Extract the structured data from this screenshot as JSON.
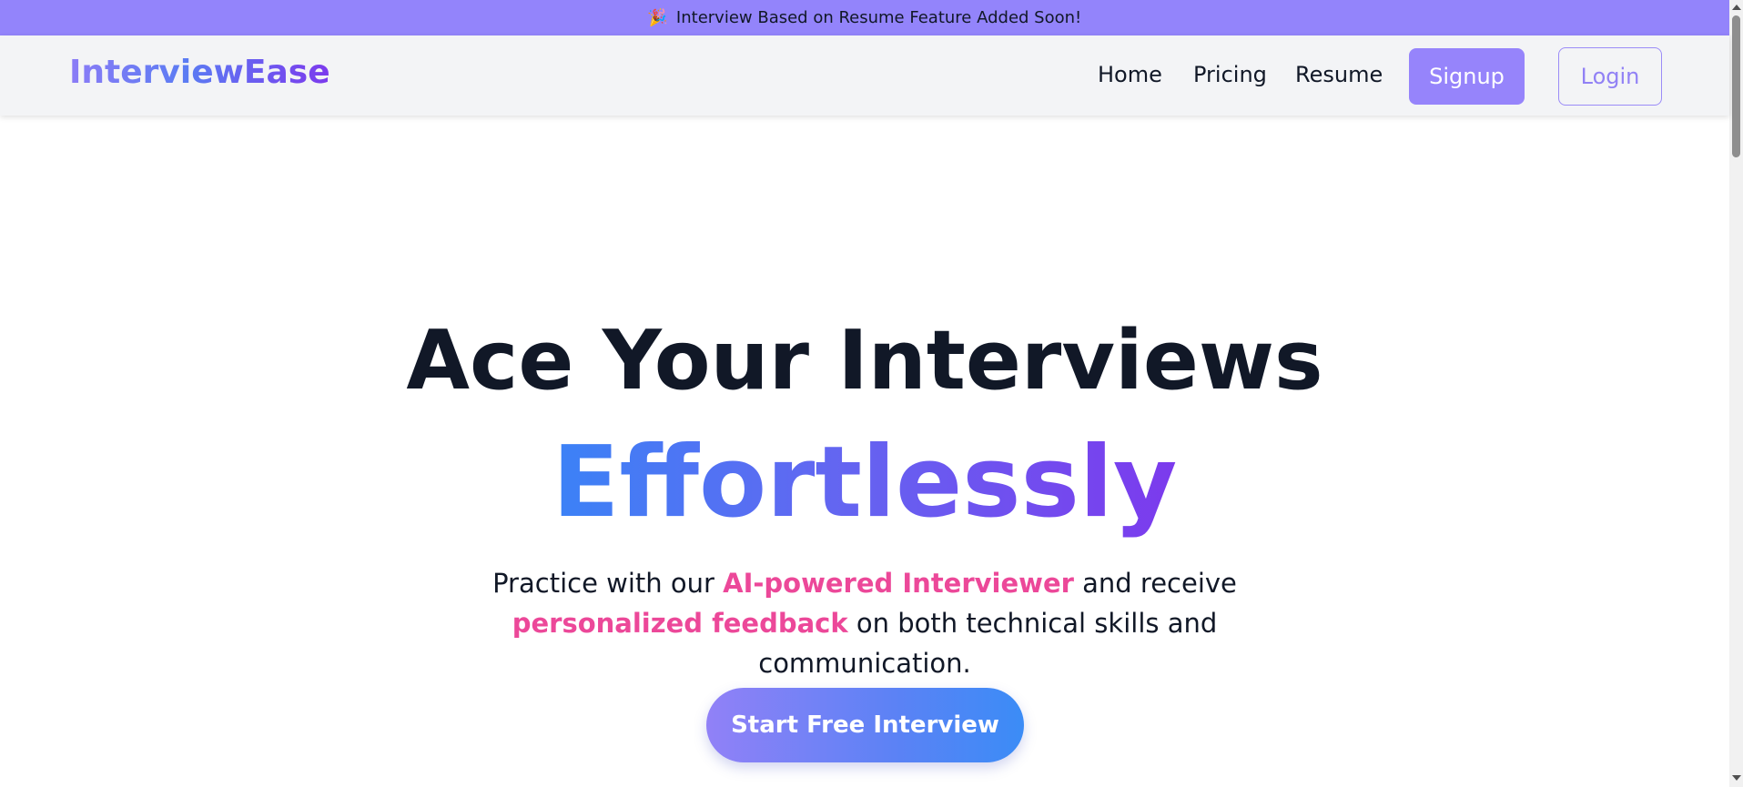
{
  "announcement": {
    "icon": "party-popper-icon",
    "icon_glyph": "🎉",
    "text": "Interview Based on Resume Feature Added Soon!"
  },
  "navbar": {
    "logo": "InterviewEase",
    "links": [
      {
        "label": "Home"
      },
      {
        "label": "Pricing"
      },
      {
        "label": "Resume"
      }
    ],
    "signup_label": "Signup",
    "login_label": "Login"
  },
  "hero": {
    "title_line1": "Ace Your Interviews",
    "title_line2": "Effortlessly",
    "subtitle": {
      "part1": "Practice with our ",
      "highlight1": "AI-powered Interviewer",
      "part2": " and receive ",
      "highlight2": "personalized feedback",
      "part3": " on both technical skills and communication."
    },
    "cta_label": "Start Free Interview"
  },
  "colors": {
    "announcement_bg": "#9384fb",
    "navbar_bg": "#f3f4f6",
    "accent_purple": "#9684fb",
    "highlight_pink": "#ec4899",
    "title_dark": "#111827",
    "gradient_blue": "#3b82f6",
    "gradient_violet": "#7c3aed"
  }
}
